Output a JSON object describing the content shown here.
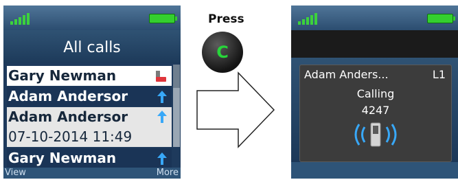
{
  "left_screen": {
    "title": "All calls",
    "calls": [
      {
        "name": "Gary Newman",
        "icon": "missed-call-handset-icon"
      },
      {
        "name": "Adam Andersor",
        "icon": "outgoing-arrow-icon"
      }
    ],
    "selected": {
      "name": "Adam Andersor",
      "datetime": "07-10-2014 11:49",
      "icon": "outgoing-arrow-icon"
    },
    "last_call": {
      "name": "Gary Newman",
      "icon": "outgoing-arrow-icon"
    },
    "softkeys": {
      "left": "View",
      "right": "More"
    }
  },
  "instruction": {
    "label": "Press",
    "key_symbol": "C"
  },
  "right_screen": {
    "contact": "Adam Anders...",
    "line": "L1",
    "status": "Calling",
    "number": "4247"
  },
  "colors": {
    "signal": "#3cd23c",
    "battery": "#34cf2f",
    "header_blue": "#2c4d70",
    "row_dark": "#1a3456",
    "arrow_icon": "#38a8f8",
    "missed_icon": "#e0353b",
    "call_key_symbol": "#27d53a"
  }
}
